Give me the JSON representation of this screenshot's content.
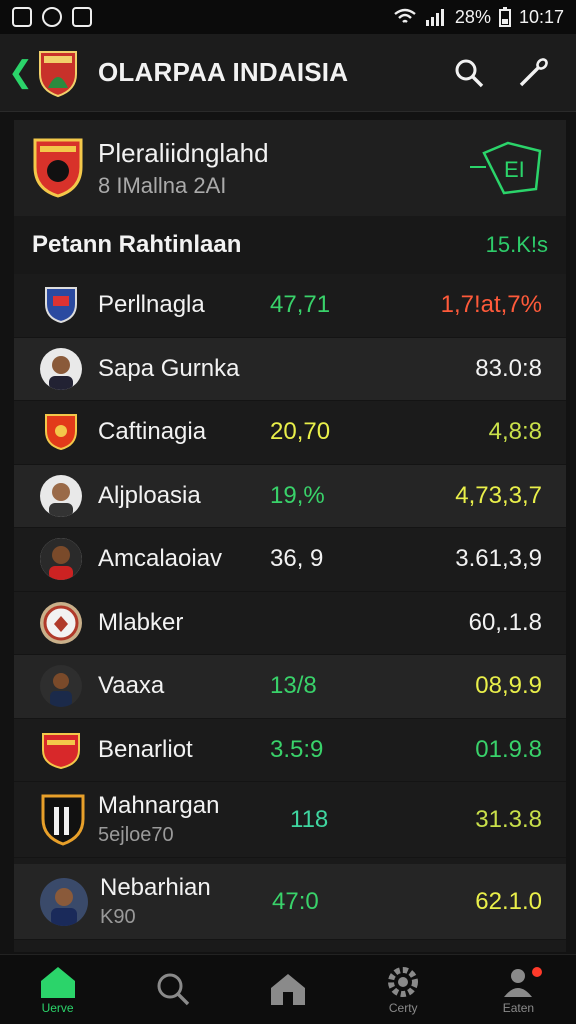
{
  "status_bar": {
    "battery": "28%",
    "time": "10:17",
    "left_icons": [
      "nfc-icon",
      "notification-icon",
      "sim-icon"
    ]
  },
  "app_bar": {
    "title": "OLARPAA INDAISIA"
  },
  "team": {
    "name": "Pleraliidnglahd",
    "subtitle": "8 IMallna 2AI"
  },
  "section": {
    "title": "Petann Rahtinlaan",
    "value": "15.K!s"
  },
  "rows": [
    {
      "name": "Perllnagla",
      "sub": "",
      "value1": "47,71",
      "value2": "1,7!at,7%"
    },
    {
      "name": "Sapa Gurnka",
      "sub": "",
      "value1": "",
      "value2": "83.0:8"
    },
    {
      "name": "Caftinagia",
      "sub": "",
      "value1": "20,70",
      "value2": "4,8:8"
    },
    {
      "name": "Aljploasia",
      "sub": "",
      "value1": "19,%",
      "value2": "4,73,3,7"
    },
    {
      "name": "Amcalaoiav",
      "sub": "",
      "value1": "36, 9",
      "value2": "3.61,3,9"
    },
    {
      "name": "Mlabker",
      "sub": "",
      "value1": "",
      "value2": "60,.1.8"
    },
    {
      "name": "Vaaxa",
      "sub": "",
      "value1": "13/8",
      "value2": "08,9.9"
    },
    {
      "name": "Benarliot",
      "sub": "",
      "value1": "3.5:9",
      "value2": "01.9.8"
    },
    {
      "name": "Mahnargan",
      "sub": "5ejloe70",
      "value1": "118",
      "value2": "31.3.8"
    },
    {
      "name": "Nebarhian",
      "sub": "K90",
      "value1": "47:0",
      "value2": "62.1.0"
    }
  ],
  "bottom_nav": [
    {
      "label": "Uerve",
      "icon": "home-icon"
    },
    {
      "label": "",
      "icon": "search-icon"
    },
    {
      "label": "",
      "icon": "stadium-icon"
    },
    {
      "label": "Certy",
      "icon": "settings-icon"
    },
    {
      "label": "Eaten",
      "icon": "profile-icon"
    }
  ],
  "colors": {
    "accent": "#2bd46a",
    "background": "#121212",
    "negative": "#ff5a3a"
  }
}
